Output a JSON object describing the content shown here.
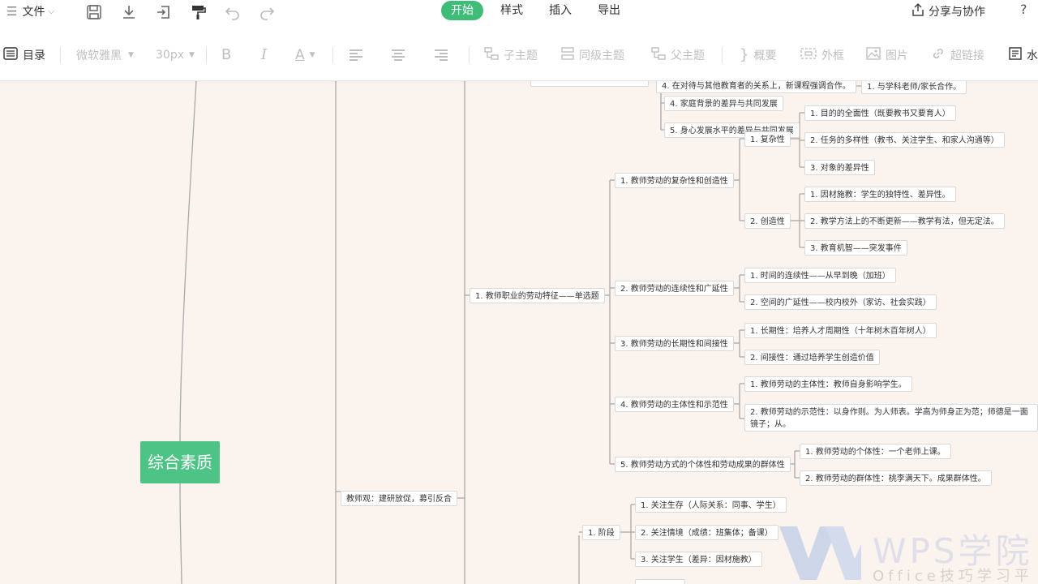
{
  "topbar": {
    "file_menu": "文件",
    "tabs": [
      {
        "label": "开始",
        "active": true
      },
      {
        "label": "样式",
        "active": false
      },
      {
        "label": "插入",
        "active": false
      },
      {
        "label": "导出",
        "active": false
      }
    ],
    "share_label": "分享与协作",
    "help_label": "?"
  },
  "toolbar": {
    "outline_label": "目录",
    "font_family": "微软雅黑",
    "font_size": "30px",
    "bold": "B",
    "italic": "I",
    "text_color": "A",
    "child_topic": "子主题",
    "sibling_topic": "同级主题",
    "parent_topic": "父主题",
    "summary": "概要",
    "frame": "外框",
    "image": "图片",
    "hyperlink": "超链接",
    "watermark": "水"
  },
  "mindmap": {
    "root": "综合素质",
    "branch_concept": "教师观：建研放促，募引反合",
    "labor_main": "1. 教师职业的劳动特征——单选题",
    "top_nodes": {
      "t4": "4. 在对待与其他教育者的关系上，新课程强调合作。",
      "t4_child": "1. 与学科老师/家长合作。",
      "t5": "4. 家庭背景的差异与共同发展",
      "t6": "5. 身心发展水平的差异与共同发展"
    },
    "labor": [
      {
        "label": "1. 教师劳动的复杂性和创造性",
        "groups": [
          {
            "label": "1. 复杂性",
            "items": [
              "1. 目的的全面性（既要教书又要育人）",
              "2. 任务的多样性（教书、关注学生、和家人沟通等）",
              "3. 对象的差异性"
            ]
          },
          {
            "label": "2. 创造性",
            "items": [
              "1. 因材施教：学生的独特性、差异性。",
              "2. 教学方法上的不断更新——教学有法，但无定法。",
              "3. 教育机智——突发事件"
            ]
          }
        ]
      },
      {
        "label": "2. 教师劳动的连续性和广延性",
        "items": [
          "1. 时间的连续性——从早到晚（加班）",
          "2. 空间的广延性——校内校外（家访、社会实践）"
        ]
      },
      {
        "label": "3. 教师劳动的长期性和间接性",
        "items": [
          "1. 长期性：培养人才周期性（十年树木百年树人）",
          "2. 间接性：通过培养学生创造价值"
        ]
      },
      {
        "label": "4. 教师劳动的主体性和示范性",
        "items": [
          "1. 教师劳动的主体性：教师自身影响学生。",
          "2. 教师劳动的示范性：以身作则。为人师表。学高为师身正为范；师德是一面镜子；从。"
        ]
      },
      {
        "label": "5. 教师劳动方式的个体性和劳动成果的群体性",
        "items": [
          "1. 教师劳动的个体性：一个老师上课。",
          "2. 教师劳动的群体性：桃李满天下。成果群体性。"
        ]
      }
    ],
    "stage": {
      "label": "1. 阶段",
      "items": [
        "1. 关注生存（人际关系：同事、学生）",
        "2. 关注情境（成绩：班集体；备课）",
        "3. 关注学生（差异：因材施教）"
      ]
    }
  },
  "watermark": {
    "brand": "WPS学院",
    "subtitle": "Office技巧学习平台"
  },
  "colors": {
    "accent": "#3ebc78",
    "root": "#4dc386",
    "canvas": "#fbf3ee",
    "line": "#aaaaaa"
  }
}
